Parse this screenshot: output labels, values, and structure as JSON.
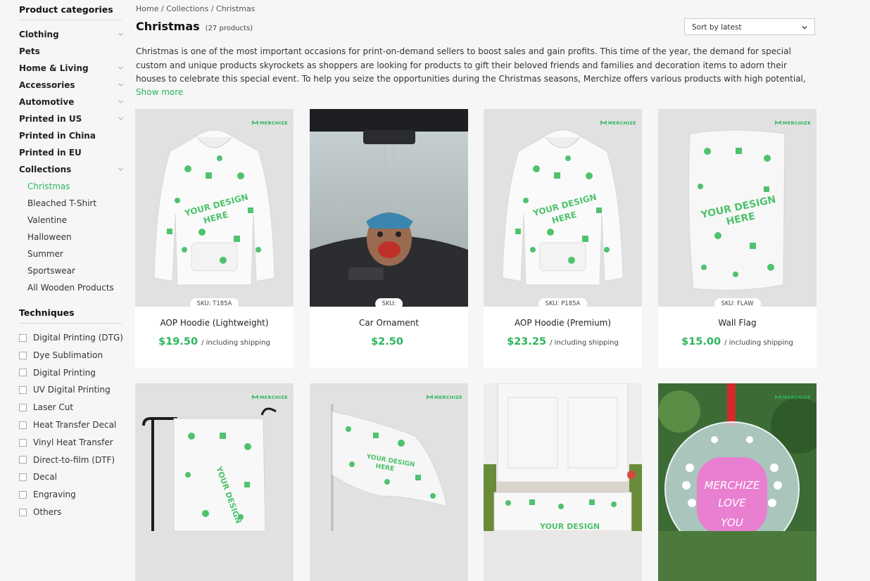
{
  "sidebar": {
    "categories_heading": "Product categories",
    "categories": [
      {
        "label": "Clothing",
        "expandable": true
      },
      {
        "label": "Pets",
        "expandable": false
      },
      {
        "label": "Home & Living",
        "expandable": true
      },
      {
        "label": "Accessories",
        "expandable": true
      },
      {
        "label": "Automotive",
        "expandable": true
      },
      {
        "label": "Printed in US",
        "expandable": true
      },
      {
        "label": "Printed in China",
        "expandable": false
      },
      {
        "label": "Printed in EU",
        "expandable": false
      },
      {
        "label": "Collections",
        "expandable": true
      }
    ],
    "collections": [
      "Christmas",
      "Bleached T-Shirt",
      "Valentine",
      "Halloween",
      "Summer",
      "Sportswear",
      "All Wooden Products"
    ],
    "techniques_heading": "Techniques",
    "techniques": [
      "Digital Printing (DTG)",
      "Dye Sublimation",
      "Digital Printing",
      "UV Digital Printing",
      "Laser Cut",
      "Heat Transfer Decal",
      "Vinyl Heat Transfer",
      "Direct-to-film (DTF)",
      "Decal",
      "Engraving",
      "Others"
    ]
  },
  "breadcrumb": {
    "home": "Home",
    "sep": " / ",
    "collections": "Collections",
    "current": "Christmas"
  },
  "page": {
    "title": "Christmas",
    "count": "(27 products)",
    "sort_label": "Sort by latest",
    "description": "Christmas is one of the most important occasions for print-on-demand sellers to boost sales and gain profits. This time of the year, the demand for special custom and unique products skyrockets as shoppers are looking for products to gift their beloved friends and families and decoration items to adorn their  houses to celebrate this special event. To help you seize the opportunities during the Christmas seasons, Merchize offers various products with high potential, from custom clothing to ornaments,",
    "show_more": "Show more"
  },
  "brand": "MERCHIZE",
  "products": [
    {
      "sku": "SKU: T185A",
      "name": "AOP Hoodie (Lightweight)",
      "price": "$19.50",
      "shipping": "/ including shipping"
    },
    {
      "sku": "SKU:",
      "name": "Car Ornament",
      "price": "$2.50",
      "shipping": ""
    },
    {
      "sku": "SKU: P185A",
      "name": "AOP Hoodie (Premium)",
      "price": "$23.25",
      "shipping": "/ including shipping"
    },
    {
      "sku": "SKU: FLAW",
      "name": "Wall Flag",
      "price": "$15.00",
      "shipping": "/ including shipping"
    }
  ],
  "ornament_text": {
    "line1": "MERCHIZE",
    "line2": "LOVE",
    "line3": "YOU"
  },
  "colors": {
    "accent": "#2db55d",
    "bg": "#f6f6f6",
    "card_img": "#e2e1e2"
  }
}
